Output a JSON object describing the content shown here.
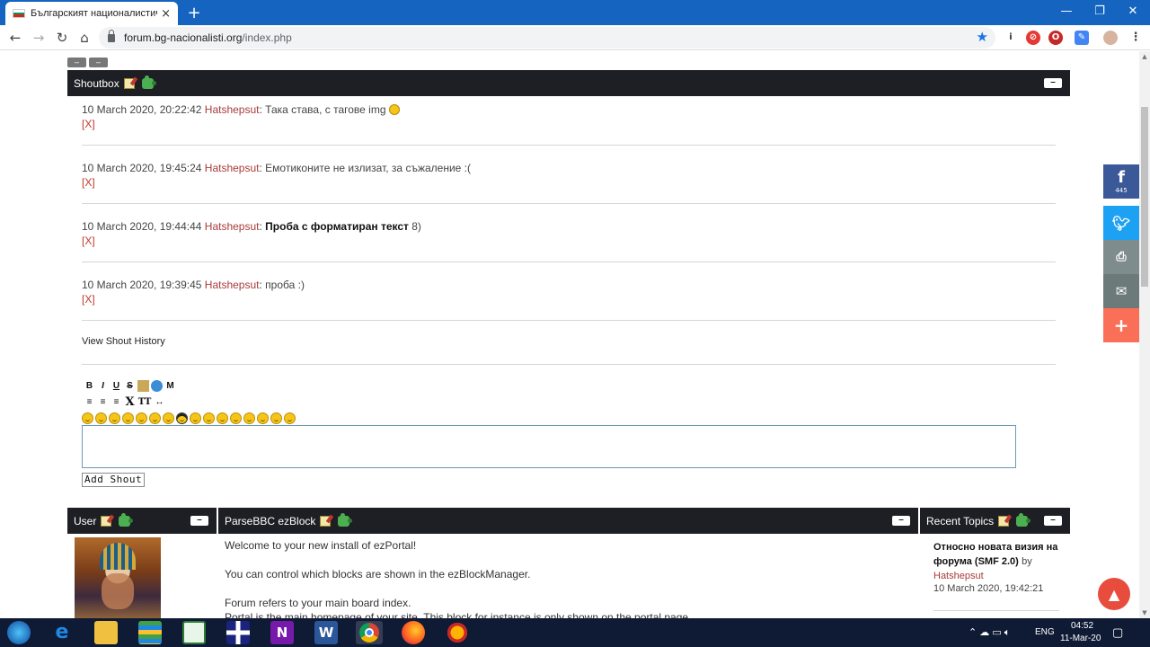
{
  "browser": {
    "tab_title": "Българският националистическ",
    "tab_close": "×",
    "new_tab": "+",
    "win_min": "—",
    "win_max": "❐",
    "win_close": "✕",
    "url_host": "forum.bg-nacionalisti.org",
    "url_path": "/index.php"
  },
  "page": {
    "collapse_buttons": [
      "–",
      "–"
    ],
    "shoutbox": {
      "title": "Shoutbox",
      "min": "–",
      "shouts": [
        {
          "time": "10 March 2020, 20:22:42",
          "name": "Hatshepsut",
          "text": ": Така става, с тагове img",
          "smiley": true,
          "bold": "",
          "suffix": "",
          "delete": "[X]"
        },
        {
          "time": "10 March 2020, 19:45:24",
          "name": "Hatshepsut",
          "text": ": Емотиконите не излизат, за съжаление  :(",
          "smiley": false,
          "bold": "",
          "suffix": "",
          "delete": "[X]"
        },
        {
          "time": "10 March 2020, 19:44:44",
          "name": "Hatshepsut",
          "text": ": ",
          "smiley": false,
          "bold": "Проба с форматиран текст",
          "suffix": "  8)",
          "delete": "[X]"
        },
        {
          "time": "10 March 2020, 19:39:45",
          "name": "Hatshepsut",
          "text": ": проба  :)",
          "smiley": false,
          "bold": "",
          "suffix": "",
          "delete": "[X]"
        }
      ],
      "history_link": "View Shout History",
      "toolbar_row1": [
        "B",
        "I",
        "U",
        "S",
        "img",
        "url",
        "M"
      ],
      "toolbar_row2": [
        "≡",
        "≡",
        "≡",
        "X",
        "TT",
        "↔"
      ],
      "emoticon_count": 16,
      "add_button": "Add Shout"
    },
    "user_block": {
      "title": "User",
      "min": "–"
    },
    "ezblock": {
      "title": "ParseBBC ezBlock",
      "min": "–",
      "lines": [
        "Welcome to your new install of ezPortal!",
        "You can control which blocks are shown in the ezBlockManager.",
        "Forum refers to your main board index.",
        "Portal is the main homepage of your site. This block for instance is only shown on the portal page."
      ]
    },
    "recent": {
      "title": "Recent Topics",
      "min": "–",
      "topic": "Относно новата визия на форума (SMF 2.0)",
      "by": "by",
      "author": "Hatshepsut",
      "date": "10 March 2020, 19:42:21"
    }
  },
  "share": {
    "facebook_count": "445",
    "colors": {
      "facebook": "#3b5998",
      "twitter": "#1da1f2",
      "print": "#7f8c8d",
      "email": "#6d7a7a",
      "more": "#fa6f57"
    }
  },
  "taskbar": {
    "lang": "ENG",
    "time": "04:52",
    "date": "11-Mar-20"
  }
}
